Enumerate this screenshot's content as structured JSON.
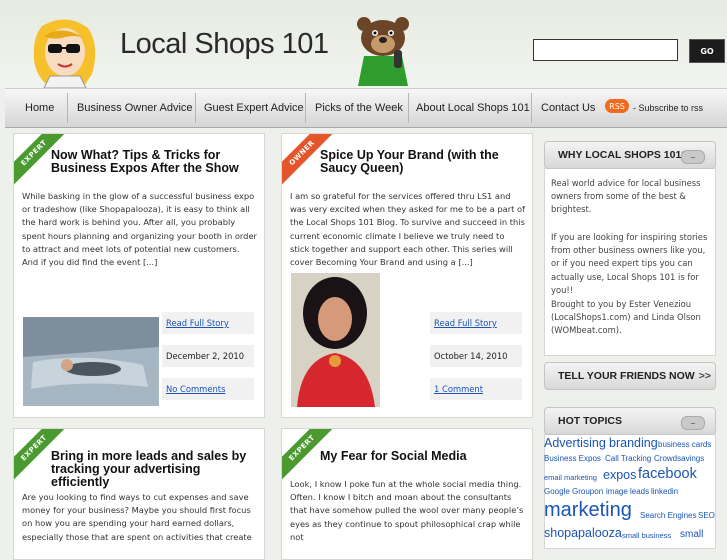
{
  "header": {
    "site_title": "Local Shops 101",
    "search_button_label": "GO",
    "search_value": ""
  },
  "nav": {
    "items": [
      {
        "label": "Home"
      },
      {
        "label": "Business Owner Advice"
      },
      {
        "label": "Guest Expert Advice"
      },
      {
        "label": "Picks of the Week"
      },
      {
        "label": "About Local Shops 101"
      },
      {
        "label": "Contact Us"
      }
    ],
    "rss_badge": "RSS",
    "rss_text": "- Subscribe to rss"
  },
  "posts": [
    {
      "tag": "EXPERT",
      "title": "Now What? Tips & Tricks for Business Expos After the Show",
      "excerpt": "While basking in the glow of a successful business expo or tradeshow (like Shopapalooza), it is easy to think all the hard work is behind you.  After all, you probably spent hours planning and organizing your booth in order to attract and meet lots of potential new customers.  And if you did find the event [...]",
      "read_more": "Read Full Story",
      "date": "December 2, 2010",
      "comments": "No Comments"
    },
    {
      "tag": "OWNER",
      "title": "Spice Up Your Brand (with the Saucy Queen)",
      "excerpt": "I am so grateful for the services offered thru LS1 and was very excited when they asked for me to be a part of the Local Shops 101 Blog. To survive and succeed in this current economic climate I believe we truly need to stick together and support each other. This series will cover Becoming Your Brand and using a [...]",
      "read_more": "Read Full Story",
      "date": "October 14, 2010",
      "comments": "1 Comment"
    },
    {
      "tag": "EXPERT",
      "title": "Bring in more leads and sales by tracking your advertising efficiently",
      "excerpt": "Are you looking to find ways to cut expenses and save money for your business? Maybe you should first focus on how you are spending your hard earned dollars, especially those that are spent on activities that create"
    },
    {
      "tag": "EXPERT",
      "title": "My Fear for Social Media",
      "excerpt": "  Look, I know I poke fun at the whole social media thing. Often. I know I bitch and moan about the consultants that have somehow pulled the wool over many people’s eyes as they continue to spout philosophical crap while not"
    }
  ],
  "sidebar": {
    "why_title": "WHY LOCAL SHOPS 101?",
    "why_p1": "Real world advice for local business owners from some of the best & brightest.",
    "why_p2": "If you are looking for inspiring stories from other business owners like you, or if you need expert tips you can actually use, Local Shops 101 is for you!!",
    "why_p3": "Brought to you by Ester Veneziou (LocalShops1.com) and Linda Olson (WOMbeat.com).",
    "tell_title": "TELL YOUR FRIENDS NOW",
    "tell_arrow": ">>",
    "topics_title": "HOT TOPICS",
    "tags": [
      "Advertising",
      "branding",
      "business cards",
      "Business Expos",
      "Call Tracking",
      "Crowdsavings",
      "email marketing",
      "expos",
      "facebook",
      "Google Groupon",
      "image",
      "leads",
      "linkedin",
      "marketing",
      "Search Engines",
      "SEO",
      "shopapalooza",
      "small business",
      "small"
    ]
  },
  "colors": {
    "expert_ribbon": "#4a9a2f",
    "owner_ribbon": "#e4552b",
    "link": "#1a55b7",
    "rss": "#f26a1b"
  }
}
